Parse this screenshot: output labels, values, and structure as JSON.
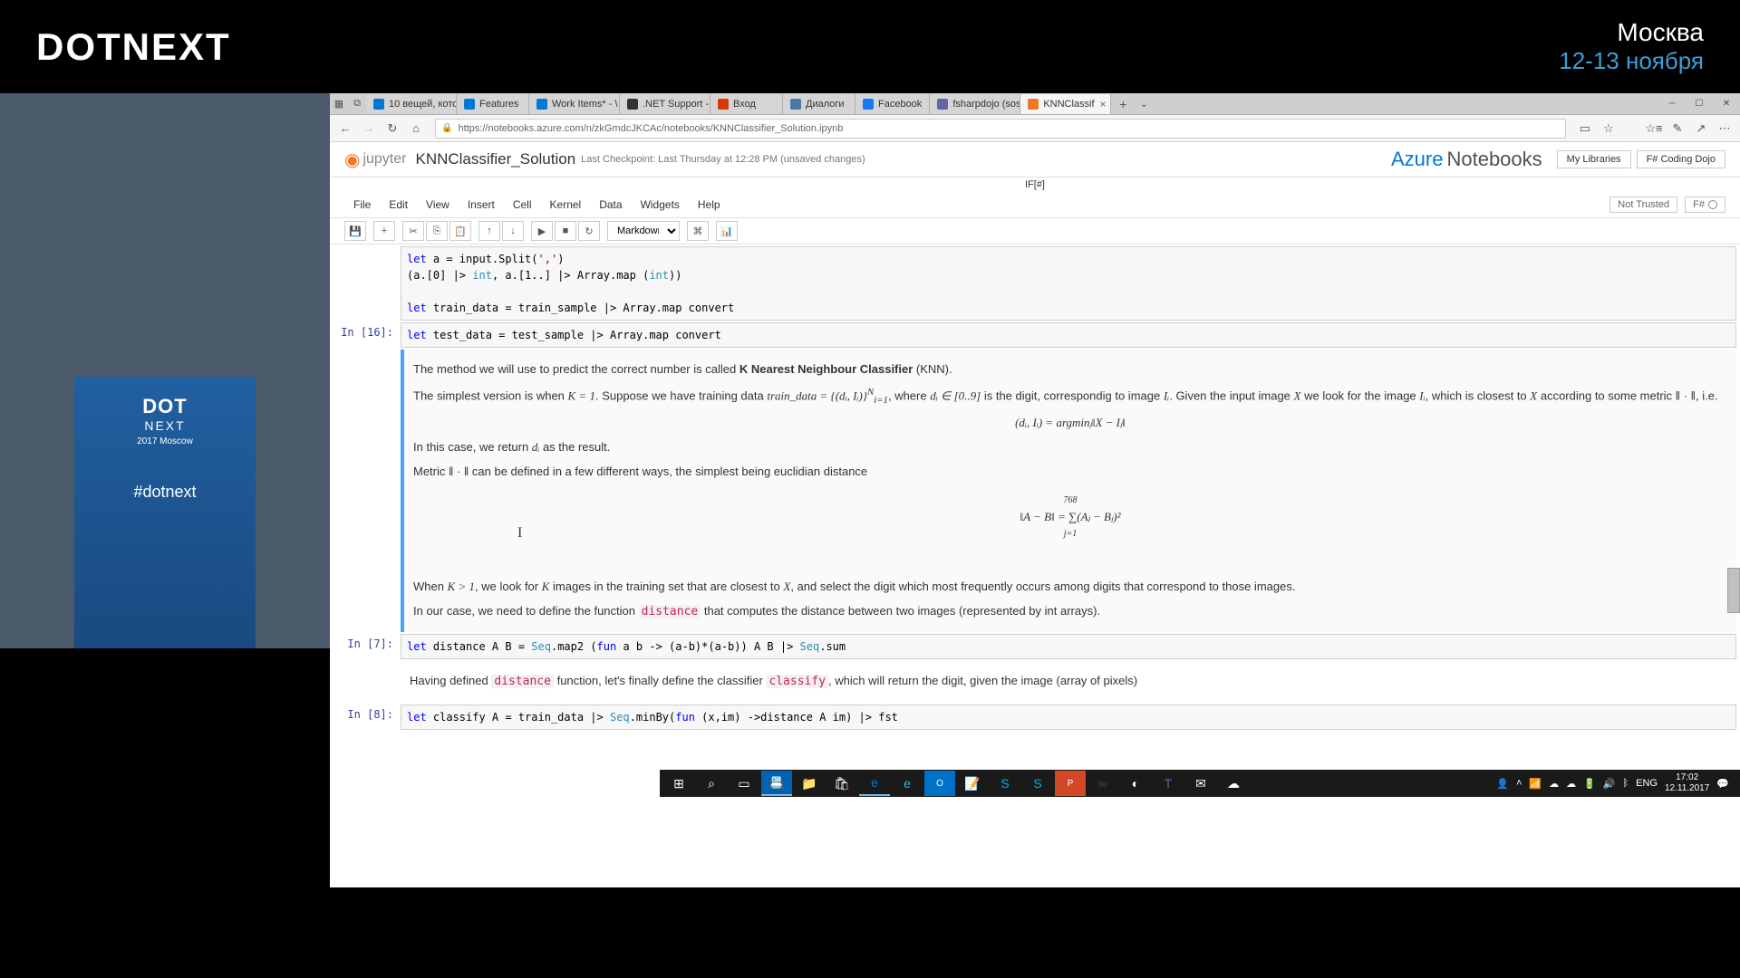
{
  "overlay": {
    "brand": "DOTNEXT",
    "city": "Москва",
    "dates": "12-13 ноября"
  },
  "podium": {
    "logo_top": "DOT",
    "logo_bot": "NEXT",
    "year": "2017 Moscow",
    "hashtag": "#dotnext"
  },
  "browser": {
    "tabs": [
      {
        "label": "10 вещей, котс",
        "favicon": "#0078d4"
      },
      {
        "label": "Features",
        "favicon": "#0078d4"
      },
      {
        "label": "Work Items* - \\",
        "favicon": "#0078d4"
      },
      {
        "label": ".NET Support -",
        "favicon": "#333"
      },
      {
        "label": "Вход",
        "favicon": "#d83b01"
      },
      {
        "label": "Диалоги",
        "favicon": "#4a76a8"
      },
      {
        "label": "Facebook",
        "favicon": "#1877f2"
      },
      {
        "label": "fsharpdojo (sos",
        "favicon": "#6264a7"
      },
      {
        "label": "KNNClassif",
        "favicon": "#f37626",
        "active": true
      }
    ],
    "url": "https://notebooks.azure.com/n/zkGmdcJKCAc/notebooks/KNNClassifier_Solution.ipynb",
    "new_tab": "+",
    "tab_more": "⌄"
  },
  "notebook": {
    "logo_text": "jupyter",
    "title": "KNNClassifier_Solution",
    "checkpoint": "Last Checkpoint: Last Thursday at 12:28 PM (unsaved changes)",
    "azure_1": "Azure",
    "azure_2": "Notebooks",
    "btn_lib": "My Libraries",
    "btn_dojo": "F# Coding Dojo",
    "sub": "IF[#]",
    "menus": [
      "File",
      "Edit",
      "View",
      "Insert",
      "Cell",
      "Kernel",
      "Data",
      "Widgets",
      "Help"
    ],
    "trust": "Not Trusted",
    "kernel": "F#",
    "celltype": "Markdown",
    "cells": {
      "c0": [
        "let a = input.Split(',')",
        "(a.[0] |> int, a.[1..] |> Array.map (int))",
        "",
        "let train_data = train_sample |> Array.map convert"
      ],
      "c1_prompt": "In [16]:",
      "c1": "let test_data = test_sample |> Array.map convert",
      "md1_a": "The method we will use to predict the correct number is called ",
      "md1_b": "K Nearest Neighbour Classifier",
      "md1_c": " (KNN).",
      "md2": "The simplest version is when K = 1. Suppose we have training data train_data = {(dᵢ, Iᵢ)}ᴺᵢ₌₁, where dᵢ ∈ [0..9] is the digit, correspondig to image Iᵢ. Given the input image X we look for the image Iᵢ, which is closest to X according to some metric ‖ · ‖, i.e.",
      "md2_eq": "(dᵢ, Iᵢ) = argminⱼ‖X − Iⱼ‖",
      "md3": "In this case, we return dᵢ as the result.",
      "md4": "Metric ‖ · ‖ can be defined in a few different ways, the simplest being euclidian distance",
      "md4_eq_top": "768",
      "md4_eq": "‖A − B‖ = ∑(Aⱼ − Bⱼ)²",
      "md4_eq_bot": "j=1",
      "cursor": "I",
      "md5": "When K > 1, we look for K images in the training set that are closest to X, and select the digit which most frequently occurs among digits that correspond to those images.",
      "md6_a": "In our case, we need to define the function ",
      "md6_b": "distance",
      "md6_c": " that computes the distance between two images (represented by int arrays).",
      "c3_prompt": "In [7]:",
      "c3": "let distance A B = Seq.map2 (fun a b -> (a-b)*(a-b)) A B |> Seq.sum",
      "md7_a": "Having defined ",
      "md7_b": "distance",
      "md7_c": " function, let's finally define the classifier ",
      "md7_d": "classify",
      "md7_e": ", which will return the digit, given the image (array of pixels)",
      "c4_prompt": "In [8]:",
      "c4": "let classify A = train_data |> Seq.minBy(fun (x,im) ->distance A im) |> fst"
    }
  },
  "taskbar": {
    "time": "17:02",
    "date": "12.11.2017",
    "lang": "ENG"
  }
}
